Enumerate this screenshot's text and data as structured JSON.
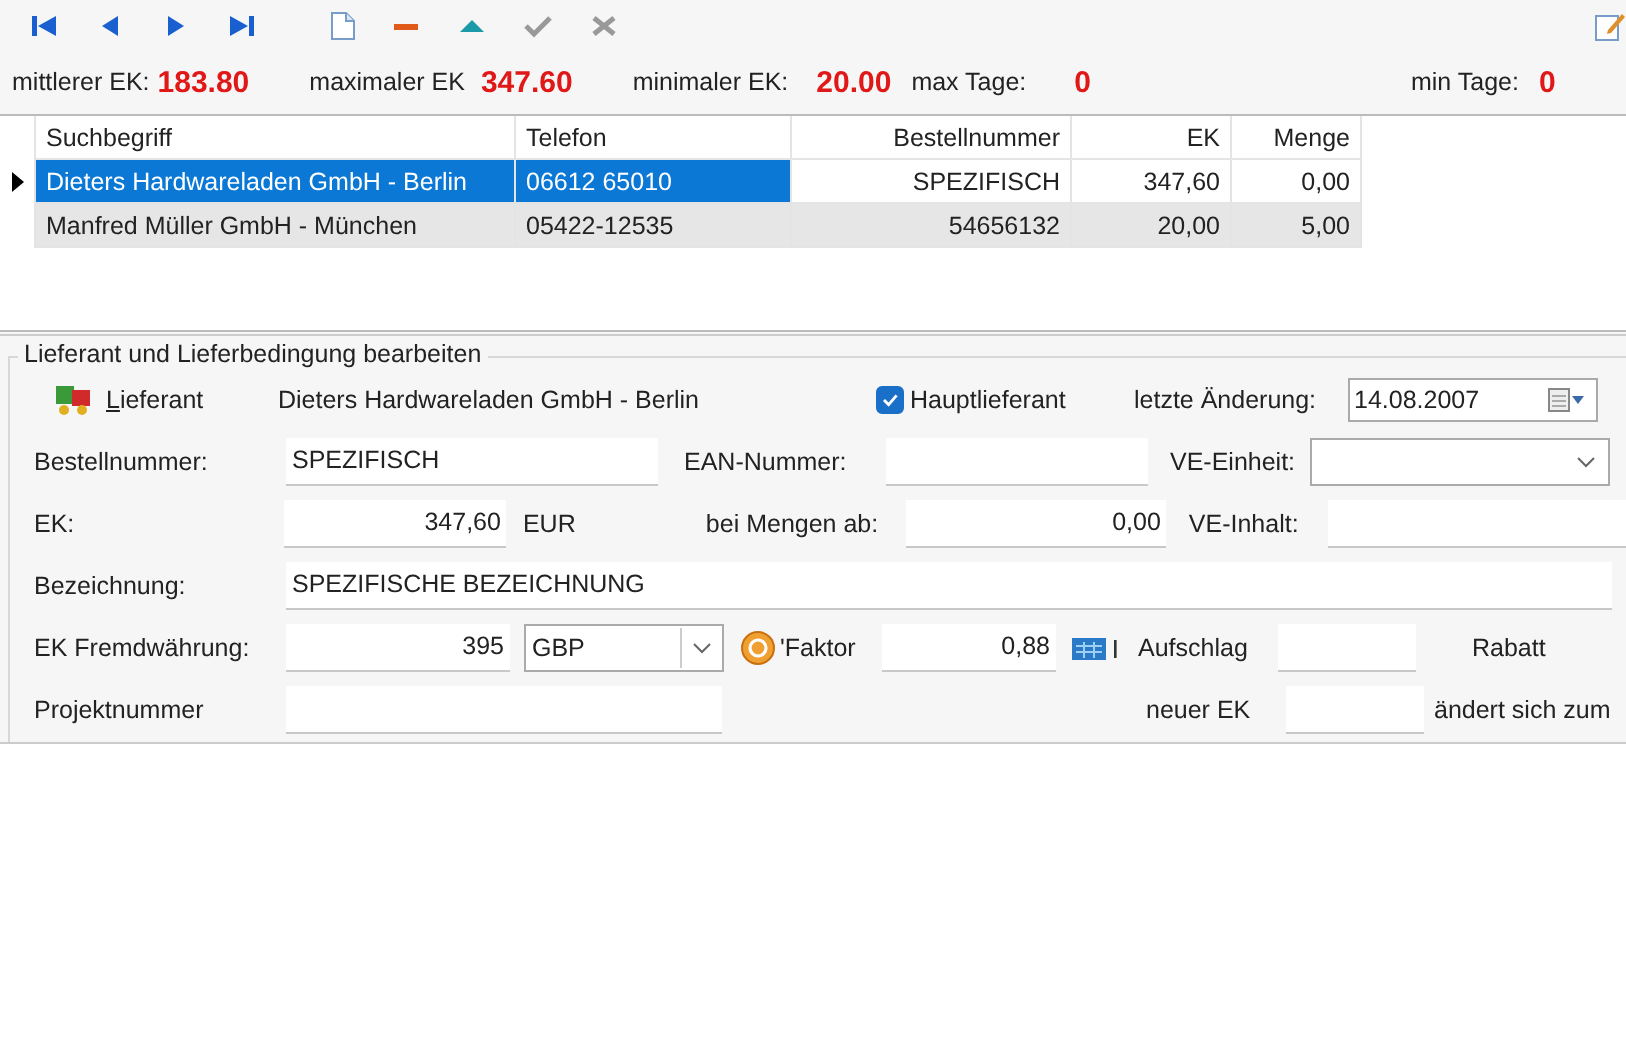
{
  "toolbar": {
    "buttons": [
      {
        "kind": "first",
        "disabled": false
      },
      {
        "kind": "prev",
        "disabled": false
      },
      {
        "kind": "next",
        "disabled": false
      },
      {
        "kind": "last",
        "disabled": false
      },
      {
        "kind": "new",
        "disabled": false
      },
      {
        "kind": "delete",
        "disabled": false
      },
      {
        "kind": "up",
        "disabled": false
      },
      {
        "kind": "confirm",
        "disabled": true
      },
      {
        "kind": "cancel",
        "disabled": true
      }
    ],
    "edit_button": {
      "disabled": false
    }
  },
  "stats": [
    {
      "label": "mittlerer EK:",
      "value": "183.80"
    },
    {
      "label": "maximaler EK",
      "value": "347.60"
    },
    {
      "label": "minimaler EK:",
      "value": "20.00"
    },
    {
      "label": "max Tage:",
      "value": "0"
    },
    {
      "label": "min Tage:",
      "value": "0"
    }
  ],
  "grid": {
    "columns": [
      "Suchbegriff",
      "Telefon",
      "Bestellnummer",
      "EK",
      "Menge"
    ],
    "rows": [
      {
        "selected": true,
        "cells": [
          "Dieters Hardwareladen GmbH - Berlin",
          "06612 65010",
          "SPEZIFISCH",
          "347,60",
          "0,00"
        ]
      },
      {
        "selected": false,
        "cells": [
          "Manfred Müller GmbH - München",
          "05422-12535",
          "54656132",
          "20,00",
          "5,00"
        ]
      }
    ]
  },
  "group": {
    "title": "Lieferant und Lieferbedingung bearbeiten",
    "supplier_label": "Lieferant",
    "supplier_name": "Dieters Hardwareladen GmbH - Berlin",
    "main_supplier": {
      "label": "Hauptlieferant",
      "checked": true
    },
    "last_change": {
      "label": "letzte Änderung:",
      "value": "14.08.2007"
    },
    "order_number": {
      "label": "Bestellnummer:",
      "value": "SPEZIFISCH"
    },
    "ean": {
      "label": "EAN-Nummer:"
    },
    "ve_unit": {
      "label": "VE-Einheit:"
    },
    "ek": {
      "label": "EK:",
      "value": "347,60",
      "currency": "EUR"
    },
    "min_qty": {
      "label": "bei Mengen ab:",
      "value": "0,00"
    },
    "ve_content": {
      "label": "VE-Inhalt:"
    },
    "description": {
      "label": "Bezeichnung:",
      "value": "SPEZIFISCHE BEZEICHNUNG"
    },
    "foreign_ek": {
      "label": "EK Fremdwährung:",
      "value": "395",
      "currency": "GBP"
    },
    "factor": {
      "label": "'Faktor",
      "value": "0,88"
    },
    "markup": {
      "label": "Aufschlag"
    },
    "discount": {
      "label": "Rabatt"
    },
    "project": {
      "label": "Projektnummer"
    },
    "new_ek": {
      "label": "neuer EK"
    },
    "changes_to": {
      "label": "ändert sich zum"
    }
  }
}
